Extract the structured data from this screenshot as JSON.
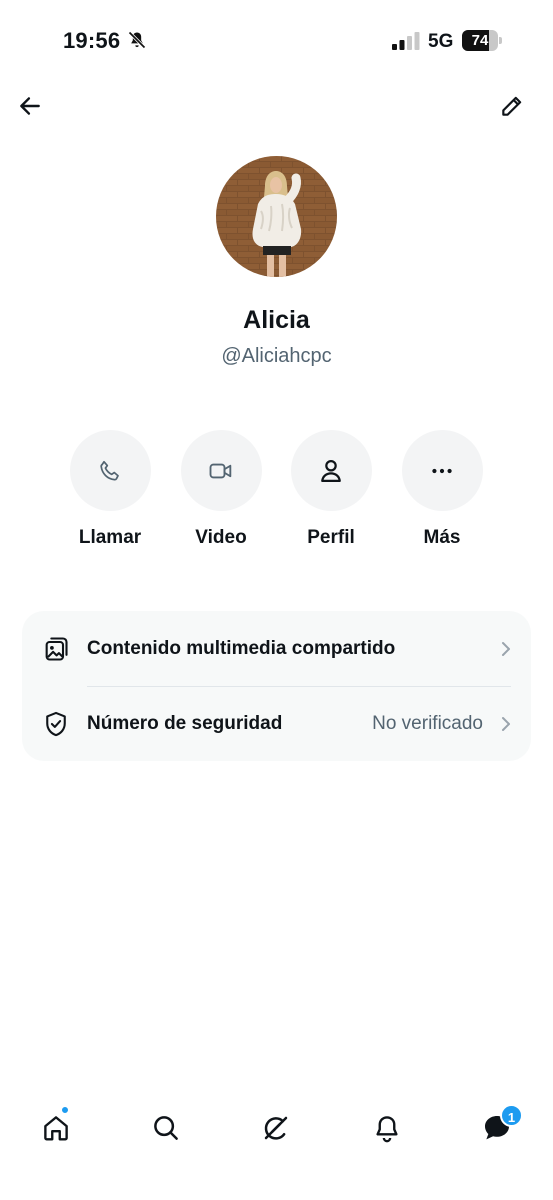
{
  "status_bar": {
    "time": "19:56",
    "network": "5G",
    "battery_level": "74",
    "battery_fraction": 0.74,
    "icons": [
      "bell-slash-icon",
      "signal-bars-icon",
      "battery-icon"
    ]
  },
  "header": {
    "back_icon": "arrow-left-icon",
    "edit_icon": "pencil-icon"
  },
  "profile": {
    "name": "Alicia",
    "handle": "@Aliciahcpc"
  },
  "actions": [
    {
      "label": "Llamar",
      "icon": "phone-icon"
    },
    {
      "label": "Video",
      "icon": "video-camera-icon"
    },
    {
      "label": "Perfil",
      "icon": "person-icon"
    },
    {
      "label": "Más",
      "icon": "more-dots-icon"
    }
  ],
  "settings": {
    "media": {
      "label": "Contenido multimedia compartido",
      "icon": "media-gallery-icon"
    },
    "security": {
      "label": "Número de seguridad",
      "value": "No verificado",
      "icon": "shield-check-icon"
    }
  },
  "bottom_nav": {
    "items": [
      "home-icon",
      "search-icon",
      "grok-icon",
      "bell-icon",
      "messages-icon"
    ],
    "messages_badge": "1"
  },
  "colors": {
    "accent": "#1d9bf0",
    "text_primary": "#0f1419",
    "text_secondary": "#536471",
    "card_bg": "#f7f9f9"
  }
}
